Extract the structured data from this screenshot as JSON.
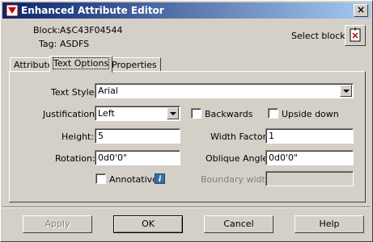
{
  "window": {
    "title": "Enhanced Attribute Editor",
    "close_symbol": "×"
  },
  "block_info": {
    "block_label": "Block:",
    "block_value": "A$C43F04544",
    "tag_label": "Tag:",
    "tag_value": "ASDFS",
    "select_block_label": "Select block"
  },
  "tabs": [
    {
      "label": "Attribute",
      "active": false
    },
    {
      "label": "Text Options",
      "active": true
    },
    {
      "label": "Properties",
      "active": false
    }
  ],
  "form": {
    "text_style_label": "Text Style:",
    "text_style_value": "Arial",
    "justification_label": "Justification:",
    "justification_value": "Left",
    "backwards_label": "Backwards",
    "backwards_checked": false,
    "upside_down_label": "Upside down",
    "upside_down_checked": false,
    "height_label": "Height:",
    "height_value": "5",
    "width_factor_label": "Width Factor:",
    "width_factor_value": "1",
    "rotation_label": "Rotation:",
    "rotation_value": "0d0'0\"",
    "oblique_label": "Oblique Angle:",
    "oblique_value": "0d0'0\"",
    "annotative_label": "Annotative",
    "annotative_checked": false,
    "boundary_label": "Boundary width:",
    "boundary_value": ""
  },
  "buttons": {
    "apply": "Apply",
    "ok": "OK",
    "cancel": "Cancel",
    "help": "Help"
  },
  "colors": {
    "title_start": "#0a246a",
    "title_end": "#a6caf0",
    "face": "#d4d0c8"
  }
}
